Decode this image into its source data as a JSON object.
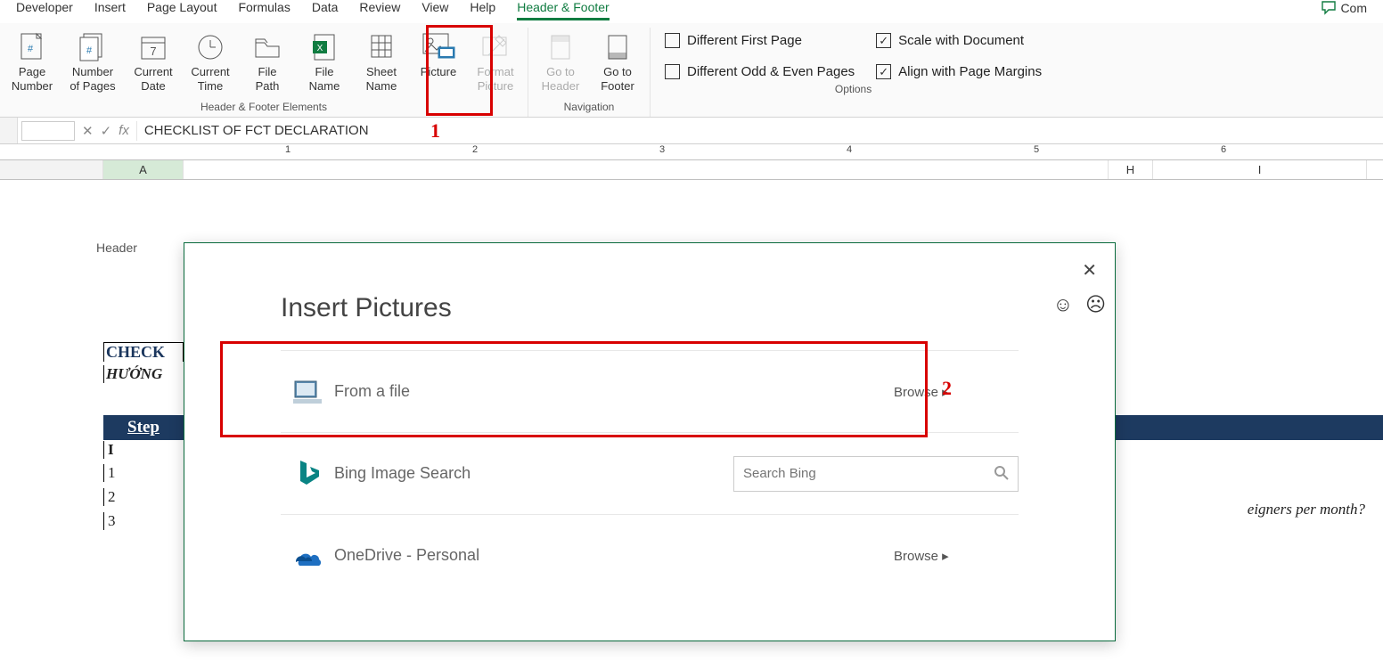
{
  "tabs": {
    "developer": "Developer",
    "insert": "Insert",
    "page_layout": "Page Layout",
    "formulas": "Formulas",
    "data": "Data",
    "review": "Review",
    "view": "View",
    "help": "Help",
    "header_footer": "Header & Footer",
    "comments": "Com"
  },
  "ribbon": {
    "elements": {
      "page_number": "Page\nNumber",
      "number_of_pages": "Number\nof Pages",
      "current_date": "Current\nDate",
      "current_time": "Current\nTime",
      "file_path": "File\nPath",
      "file_name": "File\nName",
      "sheet_name": "Sheet\nName",
      "picture": "Picture",
      "format_picture": "Format\nPicture",
      "group_label": "Header & Footer Elements"
    },
    "nav": {
      "go_header": "Go to\nHeader",
      "go_footer": "Go to\nFooter",
      "group_label": "Navigation"
    },
    "options": {
      "diff_first": "Different First Page",
      "diff_odd_even": "Different Odd & Even Pages",
      "scale_doc": "Scale with Document",
      "align_margins": "Align with Page Margins",
      "group_label": "Options"
    }
  },
  "annotations": {
    "n1": "1",
    "n2": "2"
  },
  "formula_bar": {
    "fx": "fx",
    "value": "CHECKLIST OF FCT DECLARATION"
  },
  "ruler": {
    "m1": "1",
    "m2": "2",
    "m3": "3",
    "m4": "4",
    "m5": "5",
    "m6": "6"
  },
  "columns": {
    "A": "A",
    "H": "H",
    "I": "I"
  },
  "sheet": {
    "header_label": "Header",
    "a1": "CHECK",
    "a2": "HƯỚNG",
    "step": "Step",
    "rI": "I",
    "r1": "1",
    "r2": "2",
    "r3": "3",
    "footnote": "eigners per month?"
  },
  "dialog": {
    "title": "Insert Pictures",
    "from_file": "From a file",
    "browse": "Browse  ▸",
    "bing": "Bing Image Search",
    "search_placeholder": "Search Bing",
    "onedrive": "OneDrive - Personal"
  }
}
